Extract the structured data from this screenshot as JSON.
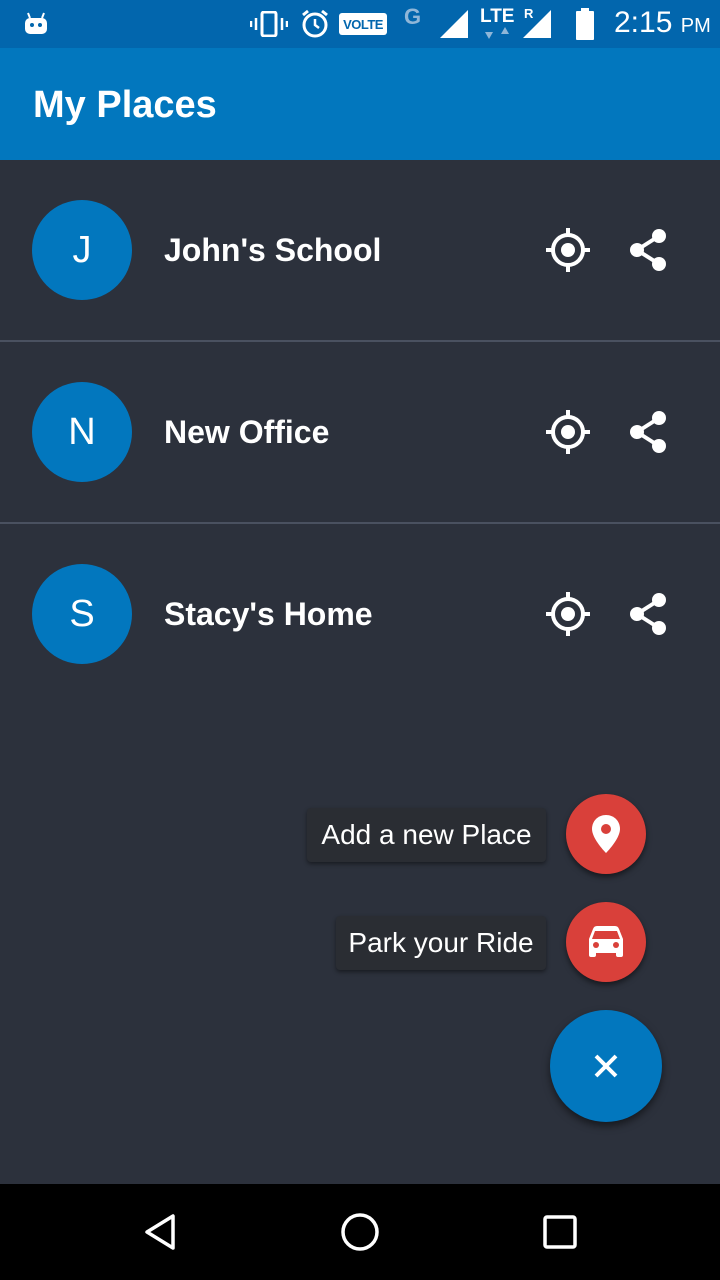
{
  "status_bar": {
    "volte": "VOLTE",
    "network_g": "G",
    "lte": "LTE",
    "roaming": "R",
    "time": "2:15",
    "ampm": "PM",
    "icons": [
      "android-icon",
      "vibrate-icon",
      "alarm-icon",
      "volte-icon",
      "signal-icon",
      "lte-signal-icon",
      "battery-icon"
    ]
  },
  "app_bar": {
    "title": "My Places"
  },
  "places": [
    {
      "initial": "J",
      "name": "John's School"
    },
    {
      "initial": "N",
      "name": "New Office"
    },
    {
      "initial": "S",
      "name": "Stacy's Home"
    }
  ],
  "fab_menu": {
    "add_place_label": "Add a new Place",
    "park_ride_label": "Park your Ride",
    "main_fab_icon": "close-icon",
    "add_place_icon": "location-pin-icon",
    "park_ride_icon": "car-icon"
  },
  "colors": {
    "primary": "#0277be",
    "status_bar": "#0266ad",
    "background": "#2c313c",
    "mini_fab": "#d9403a",
    "label_bg": "#2a2d33"
  },
  "nav_bar": {
    "icons": [
      "back-icon",
      "home-icon",
      "recents-icon"
    ]
  }
}
